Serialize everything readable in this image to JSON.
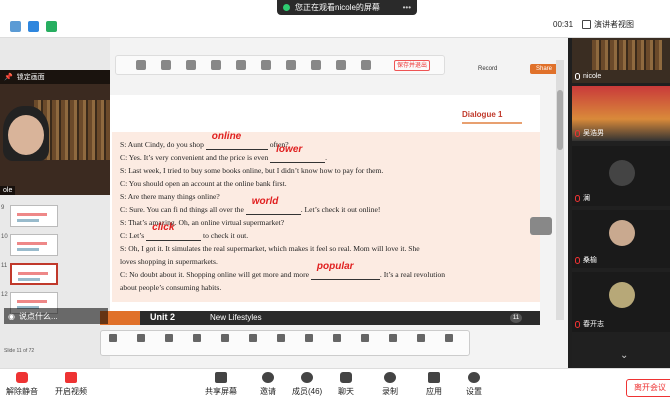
{
  "banner": {
    "text": "您正在观看nicole的屏幕"
  },
  "top": {
    "timer": "00:31",
    "view_label": "演讲者视图"
  },
  "left": {
    "fix_label": "锁定画面",
    "self_name": "ole",
    "caption": "说点什么..."
  },
  "ppt": {
    "record_label": "Record",
    "share_label": "Share",
    "red_btn": "保存并退出"
  },
  "slide": {
    "heading": "Dialogue 1",
    "lines": [
      {
        "pre": "S: Aunt Cindy, do you shop ",
        "ans": "online",
        "post": " often?"
      },
      {
        "pre": "C: Yes. It’s very convenient and the price is even ",
        "ans": "lower",
        "post": "."
      },
      {
        "pre": "S: Last week, I tried to buy some books online, but I didn’t know how to pay for them.",
        "ans": "",
        "post": ""
      },
      {
        "pre": "C: You should open an account at the online bank first.",
        "ans": "",
        "post": ""
      },
      {
        "pre": "S: Are there many things online?",
        "ans": "",
        "post": ""
      },
      {
        "pre": "C: Sure. You can fi nd things all over the ",
        "ans": "world",
        "post": ". Let’s check it out online!"
      },
      {
        "pre": "S: That’s amazing. Oh, an online virtual supermarket?",
        "ans": "",
        "post": ""
      },
      {
        "pre": "C: Let’s ",
        "ans": "click",
        "post": " to check it out."
      },
      {
        "pre": "S: Oh, I got it. It simulates the real supermarket, which makes it feel so real. Mom will love it. She",
        "ans": "",
        "post": ""
      },
      {
        "pre": "loves shopping in supermarkets.",
        "ans": "",
        "post": ""
      },
      {
        "pre": "C: No doubt about it. Shopping online will get more and more ",
        "ans": "popular",
        "post": ". It’s a real revolution"
      },
      {
        "pre": "about people’s consuming habits.",
        "ans": "",
        "post": ""
      }
    ],
    "unit": "Unit 2",
    "unit_title": "New Lifestyles",
    "page_num": "11"
  },
  "thumbs": [
    "9",
    "10",
    "11",
    "12"
  ],
  "status": "Slide 11 of 72",
  "participants": [
    {
      "name": "nicole",
      "muted": false
    },
    {
      "name": "吴浩男",
      "muted": true
    },
    {
      "name": "澜",
      "muted": true
    },
    {
      "name": "桑榆",
      "muted": true
    },
    {
      "name": "春开志",
      "muted": true
    }
  ],
  "bottom": {
    "mute": "解除静音",
    "video": "开启视频",
    "share": "共享屏幕",
    "invite": "邀请",
    "members": "成员(46)",
    "chat": "聊天",
    "record": "录制",
    "apps": "应用",
    "settings": "设置",
    "leave": "离开会议"
  },
  "colors": {
    "accent": "#e0712a",
    "answer": "#e02020",
    "pink": "#fcebe2"
  }
}
